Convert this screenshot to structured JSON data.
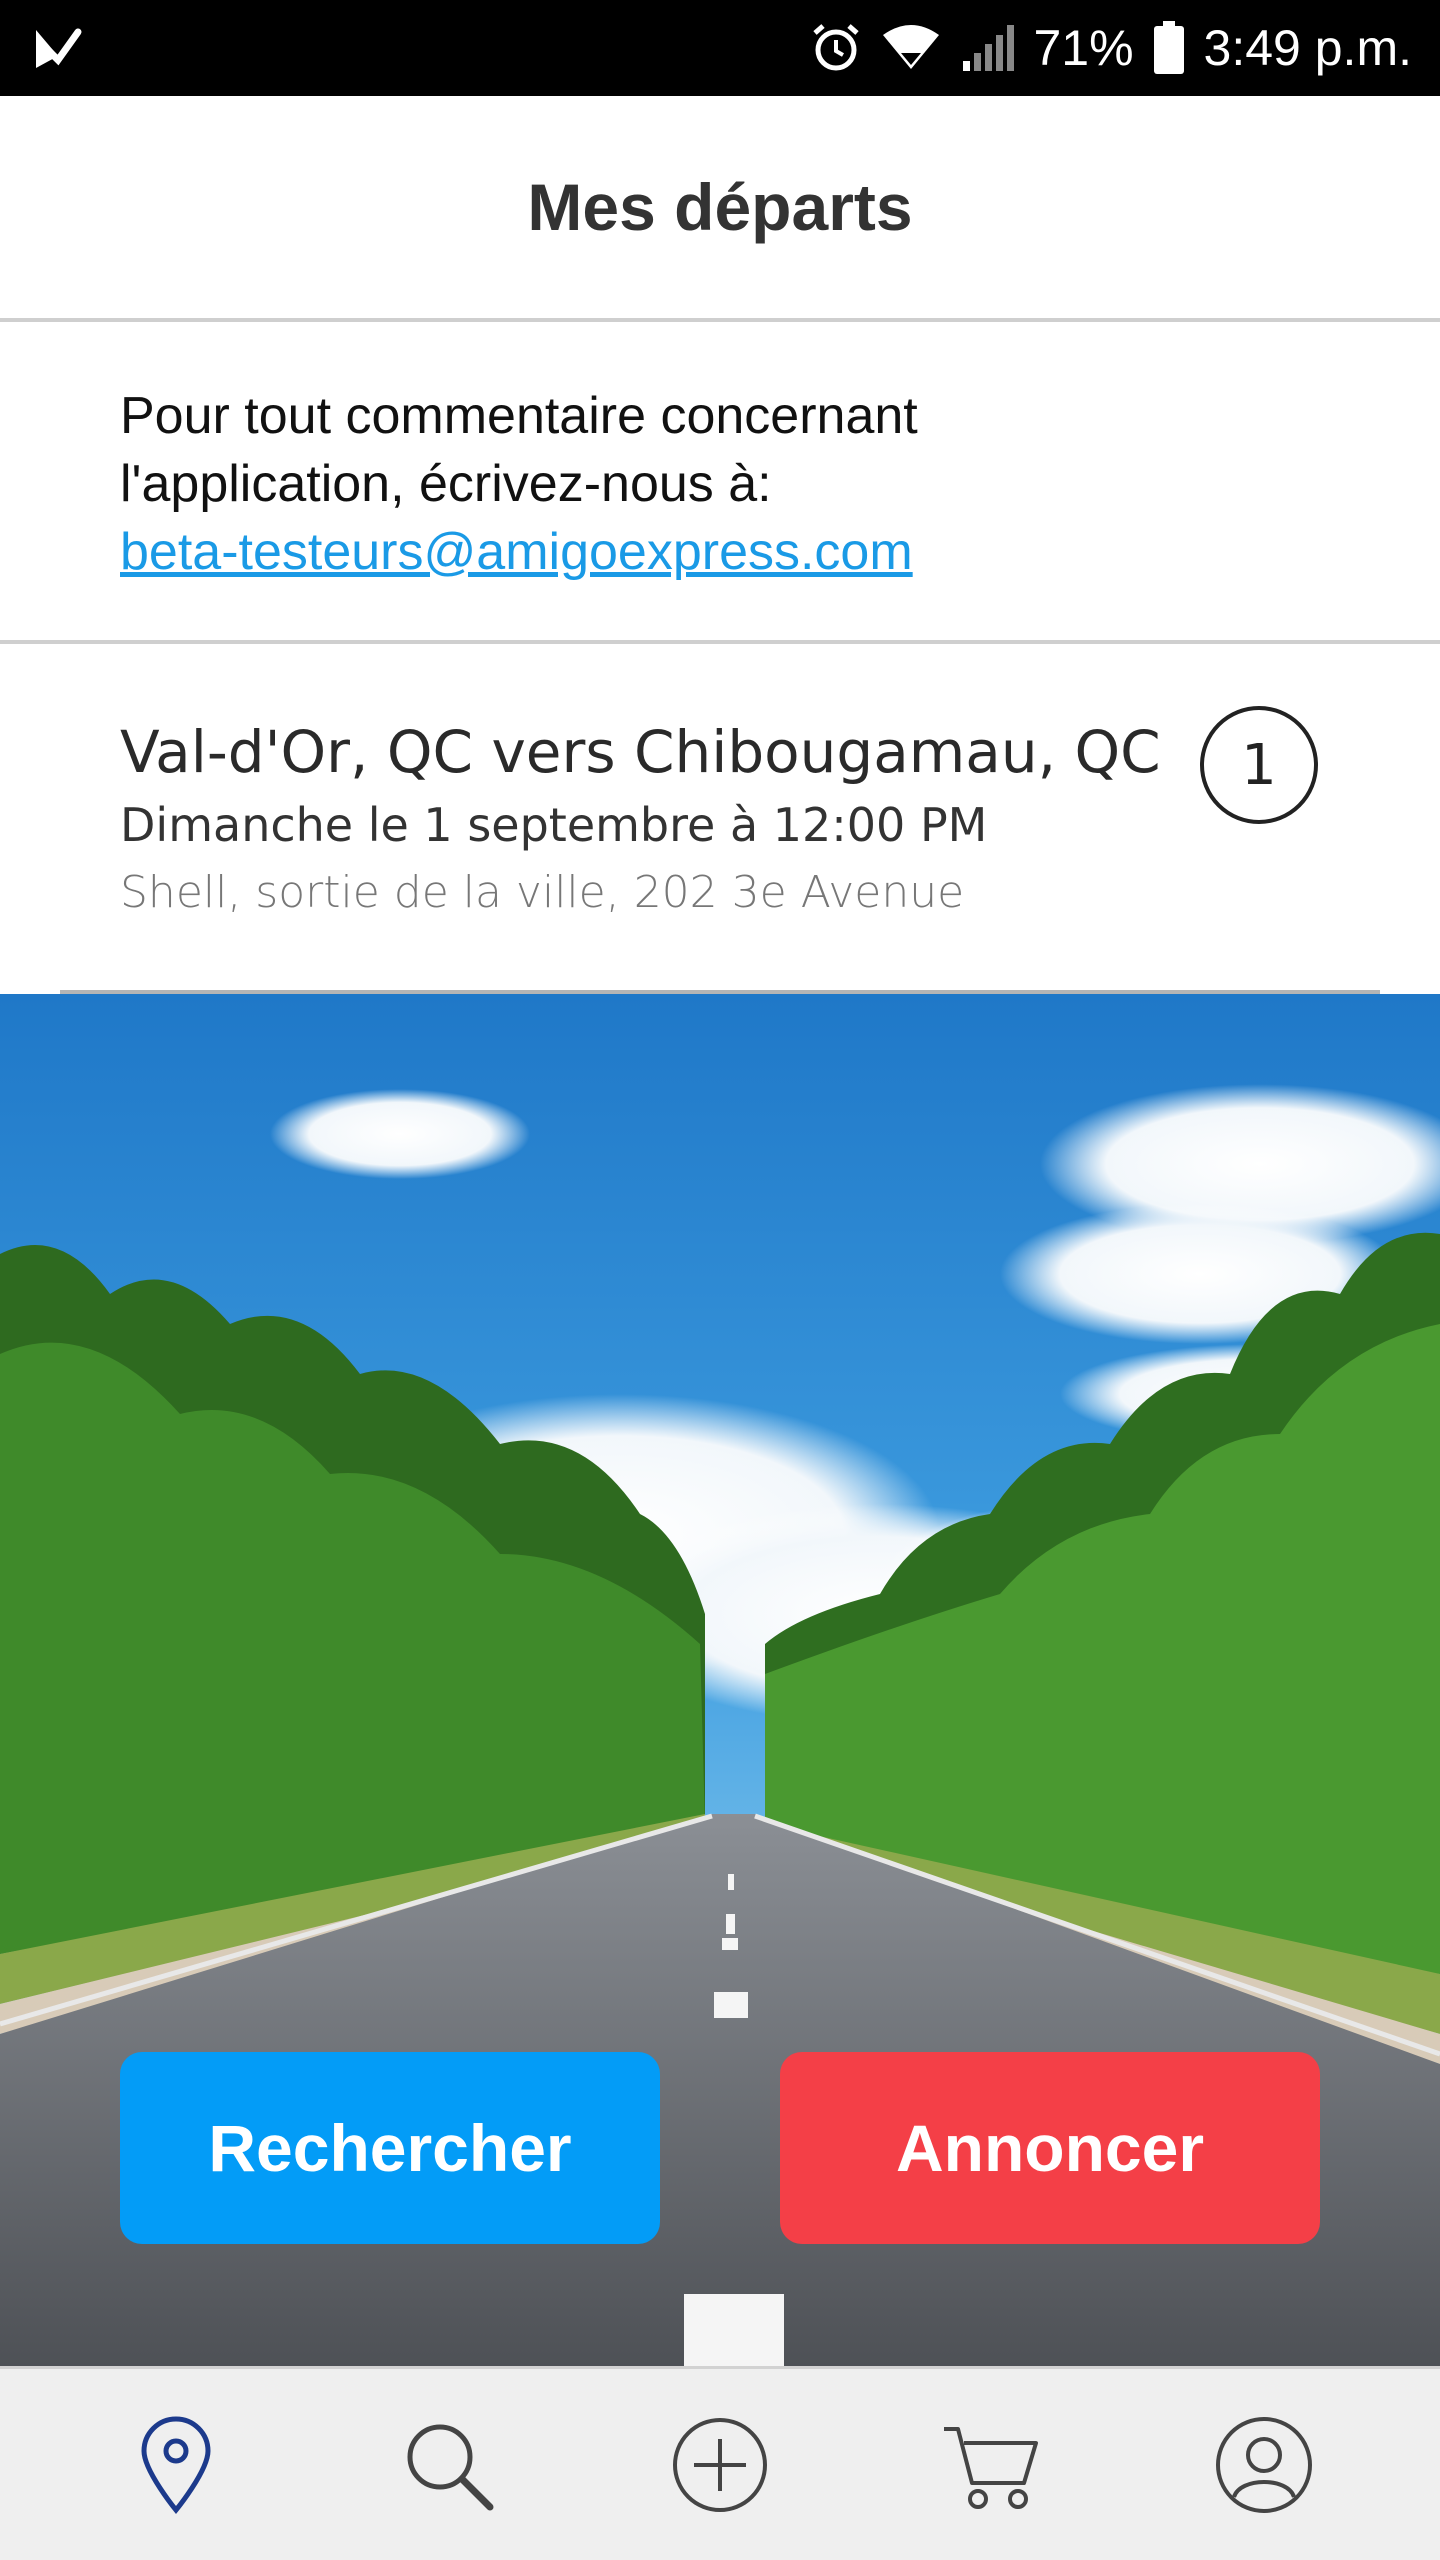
{
  "status_bar": {
    "battery": "71%",
    "time": "3:49 p.m."
  },
  "header": {
    "title": "Mes départs"
  },
  "feedback": {
    "line1": "Pour tout commentaire concernant",
    "line2": "l'application, écrivez-nous à:",
    "email": "beta-testeurs@amigoexpress.com"
  },
  "departure": {
    "route": "Val-d'Or, QC vers Chibougamau, QC",
    "date": "Dimanche le 1 septembre à 12:00 PM",
    "place": "Shell, sortie de la ville, 202 3e Avenue",
    "count": "1"
  },
  "actions": {
    "search_label": "Rechercher",
    "post_label": "Annoncer"
  },
  "colors": {
    "search_button": "#039cf7",
    "post_button": "#f43f47",
    "nav_active": "#1c3a8c",
    "link": "#1a9ae6"
  },
  "bottom_nav": {
    "items": [
      {
        "icon": "map-pin-icon",
        "active": true
      },
      {
        "icon": "search-icon",
        "active": false
      },
      {
        "icon": "plus-circle-icon",
        "active": false
      },
      {
        "icon": "cart-icon",
        "active": false
      },
      {
        "icon": "user-icon",
        "active": false
      }
    ]
  }
}
